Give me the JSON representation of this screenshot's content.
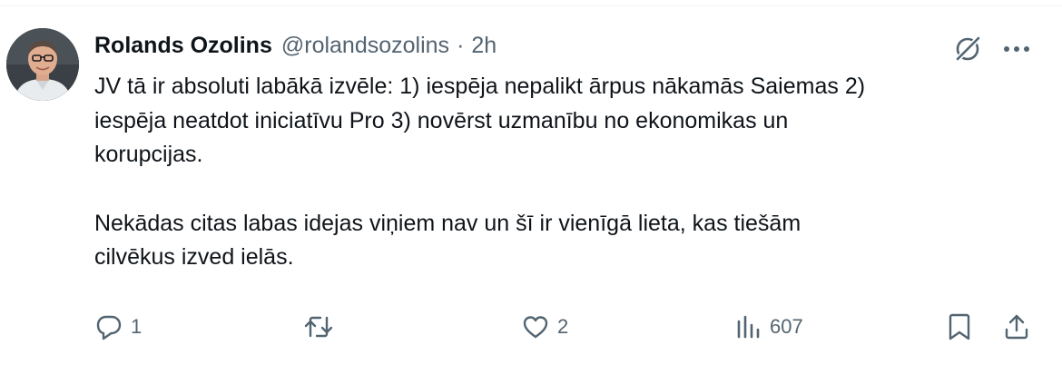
{
  "author": {
    "name": "Rolands Ozolins",
    "handle": "@rolandsozolins",
    "separator": "·",
    "time": "2h"
  },
  "tweet": {
    "paragraph1": "JV tā ir absoluti labākā izvēle: 1) iespēja nepalikt ārpus nākamās Saiemas 2)\niespēja neatdot iniciatīvu Pro 3) novērst uzmanību no ekonomikas un\nkorupcijas.",
    "paragraph2": "Nekādas citas labas idejas viņiem nav un šī ir vienīgā lieta, kas tiešām\ncilvēkus izved ielās."
  },
  "actions": {
    "replies": "1",
    "reposts": "",
    "likes": "2",
    "views": "607"
  },
  "icons": {
    "reply": "reply-icon",
    "repost": "repost-icon",
    "like": "heart-icon",
    "views": "views-chart-icon",
    "bookmark": "bookmark-icon",
    "share": "share-icon",
    "grok": "grok-icon",
    "more": "more-dots-icon"
  },
  "colors": {
    "text_primary": "#0f1419",
    "text_secondary": "#536471",
    "divider": "#eff3f4"
  }
}
